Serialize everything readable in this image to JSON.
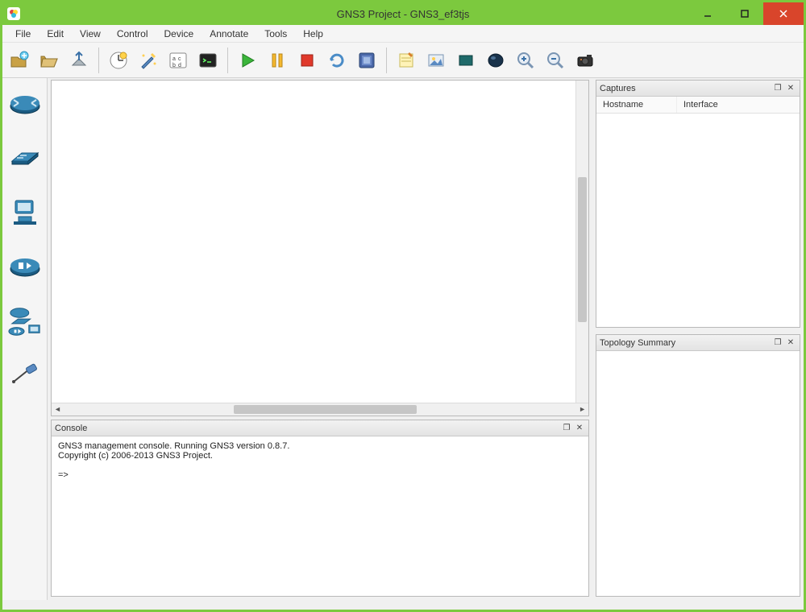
{
  "window": {
    "title": "GNS3 Project - GNS3_ef3tjs"
  },
  "menu": {
    "file": "File",
    "edit": "Edit",
    "view": "View",
    "control": "Control",
    "device": "Device",
    "annotate": "Annotate",
    "tools": "Tools",
    "help": "Help"
  },
  "toolbar": {
    "new_project": "new-project",
    "open_project": "open-project",
    "save_project": "save-project",
    "clock": "snapshot",
    "wizard": "setup-wizard",
    "labels": "show-labels",
    "terminal": "console",
    "start": "start",
    "pause": "pause",
    "stop": "stop",
    "reload": "reload",
    "vbox": "virtualbox",
    "note": "add-note",
    "picture": "add-picture",
    "rect": "add-rectangle",
    "ellipse": "add-ellipse",
    "zoom_in": "zoom-in",
    "zoom_out": "zoom-out",
    "screenshot": "screenshot"
  },
  "panels": {
    "console_title": "Console",
    "captures_title": "Captures",
    "topology_title": "Topology Summary",
    "captures_col_hostname": "Hostname",
    "captures_col_interface": "Interface"
  },
  "console": {
    "line1": "GNS3 management console. Running GNS3 version 0.8.7.",
    "line2": "Copyright (c) 2006-2013 GNS3 Project.",
    "prompt": "=>"
  }
}
